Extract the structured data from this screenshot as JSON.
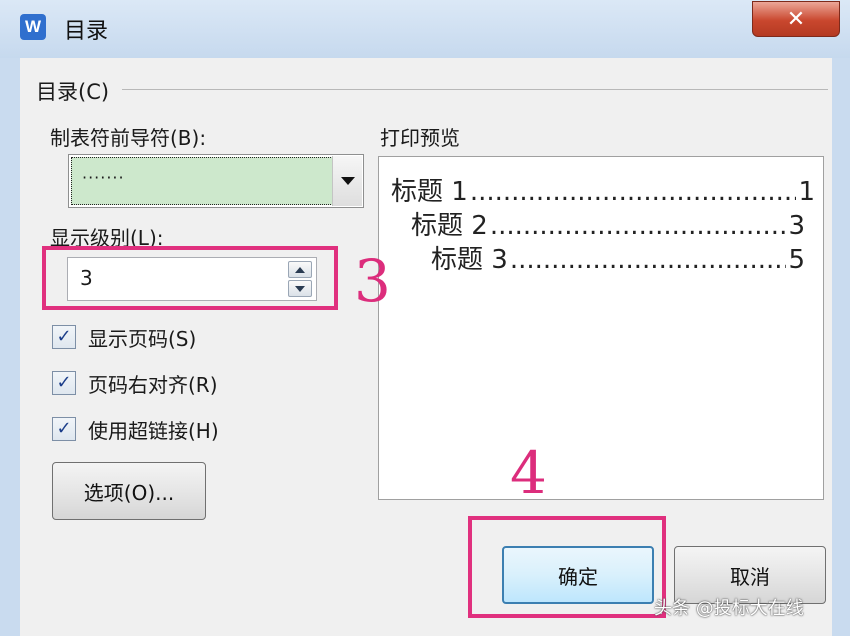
{
  "window": {
    "title": "目录",
    "app_icon_letter": "W",
    "close_label": "✕"
  },
  "group": {
    "label": "目录(C)"
  },
  "leader": {
    "label": "制表符前导符(B):",
    "value": "·······"
  },
  "level": {
    "label": "显示级别(L):",
    "value": "3"
  },
  "options": [
    {
      "label": "显示页码(S)",
      "checked": true
    },
    {
      "label": "页码右对齐(R)",
      "checked": true
    },
    {
      "label": "使用超链接(H)",
      "checked": true
    }
  ],
  "options_button": {
    "label": "选项(O)..."
  },
  "preview": {
    "label": "打印预览",
    "entries": [
      {
        "text": "标题 1",
        "dots": "............................................................",
        "page": "1"
      },
      {
        "text": "标题 2",
        "dots": "............................................................",
        "page": "3"
      },
      {
        "text": "标题 3",
        "dots": "............................................................",
        "page": "5"
      }
    ]
  },
  "buttons": {
    "ok": "确定",
    "cancel": "取消"
  },
  "annotations": {
    "step3": "3",
    "step4": "4"
  },
  "watermark": "头条 @投标大在线"
}
